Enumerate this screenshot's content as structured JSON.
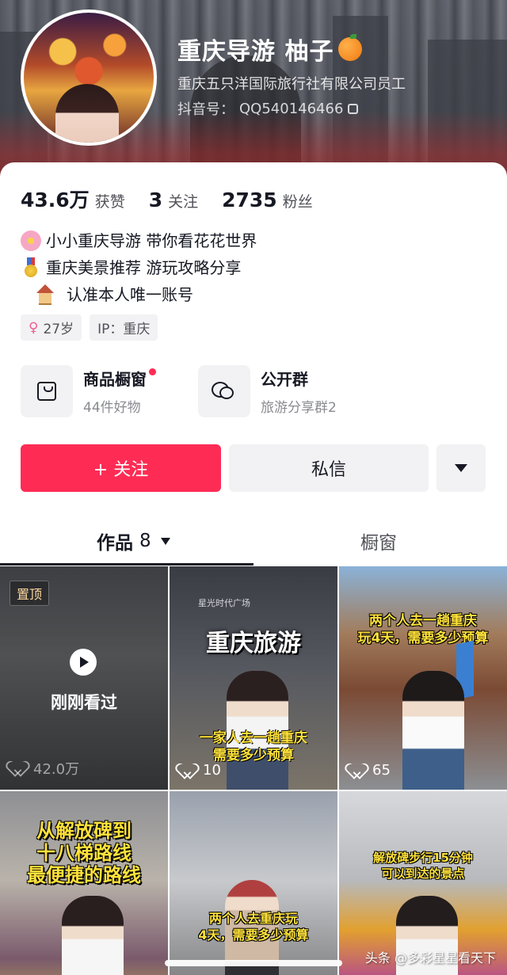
{
  "profile": {
    "name": "重庆导游 柚子",
    "company": "重庆五只洋国际旅行社有限公司员工",
    "douyin_label": "抖音号：",
    "douyin_id": "QQ540146466"
  },
  "stats": [
    {
      "num": "43.6万",
      "label": "获赞"
    },
    {
      "num": "3",
      "label": "关注"
    },
    {
      "num": "2735",
      "label": "粉丝"
    }
  ],
  "bio": {
    "line1": "小小重庆导游 带你看花花世界",
    "line2": "重庆美景推荐 游玩攻略分享",
    "line3": "认准本人唯一账号"
  },
  "tags": {
    "age": "27岁",
    "ip": "IP：重庆"
  },
  "shortcuts": [
    {
      "title": "商品橱窗",
      "sub": "44件好物"
    },
    {
      "title": "公开群",
      "sub": "旅游分享群2"
    }
  ],
  "actions": {
    "follow": "+ 关注",
    "message": "私信"
  },
  "tabs": {
    "works": "作品",
    "works_count": "8",
    "shop": "橱窗"
  },
  "videos": [
    {
      "badge": "置顶",
      "status": "刚刚看过",
      "likes": "42.0万"
    },
    {
      "sign": "星光时代广场",
      "title": "重庆旅游",
      "subtitle": "一家人去一趟重庆\n需要多少预算",
      "likes": "10"
    },
    {
      "title": "两个人去一趟重庆\n玩4天，需要多少预算",
      "likes": "65"
    },
    {
      "title": "从解放碑到\n十八梯路线\n最便捷的路线"
    },
    {
      "title": "两个人去重庆玩\n4天，需要多少预算"
    },
    {
      "title": "解放碑步行15分钟\n可以到达的景点"
    }
  ],
  "watermark": "头条 @多彩星星看天下",
  "colors": {
    "accent": "#fe2c55",
    "text_primary": "#161823",
    "text_secondary": "#8a8b91",
    "surface": "#f2f2f4",
    "overlay_yellow": "#ffe23a"
  }
}
